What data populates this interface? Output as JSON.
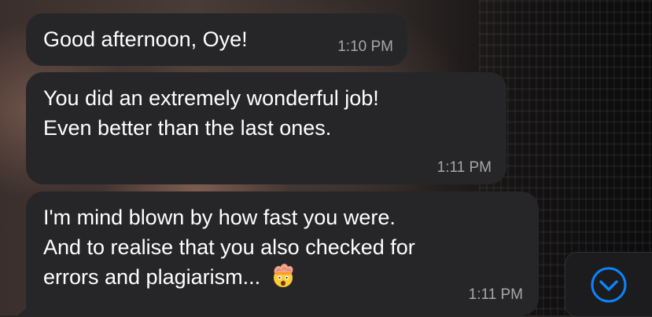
{
  "messages": [
    {
      "lines": [
        "Good afternoon, Oye!"
      ],
      "time": "1:10 PM"
    },
    {
      "lines": [
        "You did an extremely wonderful job!",
        "Even better than the last ones."
      ],
      "time": "1:11 PM"
    },
    {
      "lines": [
        "I'm mind blown by how fast you were.",
        "And to realise that you also checked for",
        "errors and plagiarism..."
      ],
      "time": "1:11 PM",
      "emoji": "exploding-head-emoji"
    }
  ],
  "scroll_button": {
    "icon": "chevron-down-circle-icon",
    "color": "#0a84ff"
  },
  "colors": {
    "bubble": "#262628",
    "text": "#ffffff",
    "timestamp": "#a7a7ab"
  }
}
